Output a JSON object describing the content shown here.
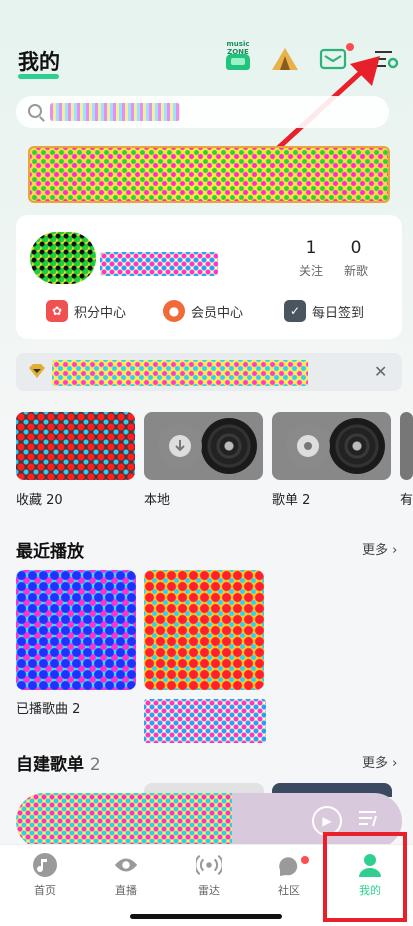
{
  "header": {
    "title": "我的",
    "zone_label": "music ZONE"
  },
  "profile": {
    "stats": [
      {
        "num": "1",
        "label": "关注"
      },
      {
        "num": "0",
        "label": "新歌"
      }
    ],
    "links": [
      {
        "label": "积分中心",
        "icon": "gift-icon"
      },
      {
        "label": "会员中心",
        "icon": "piggy-icon"
      },
      {
        "label": "每日签到",
        "icon": "calendar-check-icon"
      }
    ]
  },
  "tiles": [
    {
      "label": "收藏 20"
    },
    {
      "label": "本地"
    },
    {
      "label": "歌单 2"
    },
    {
      "label": "有"
    }
  ],
  "recent": {
    "title": "最近播放",
    "more": "更多",
    "items": [
      {
        "label": "已播歌曲 2"
      }
    ]
  },
  "playlists": {
    "title": "自建歌单",
    "count": "2",
    "more": "更多"
  },
  "tabbar": {
    "items": [
      {
        "label": "首页"
      },
      {
        "label": "直播"
      },
      {
        "label": "雷达"
      },
      {
        "label": "社区"
      },
      {
        "label": "我的"
      }
    ]
  },
  "colors": {
    "accent": "#2fd08f",
    "highlight": "#e8202a"
  }
}
